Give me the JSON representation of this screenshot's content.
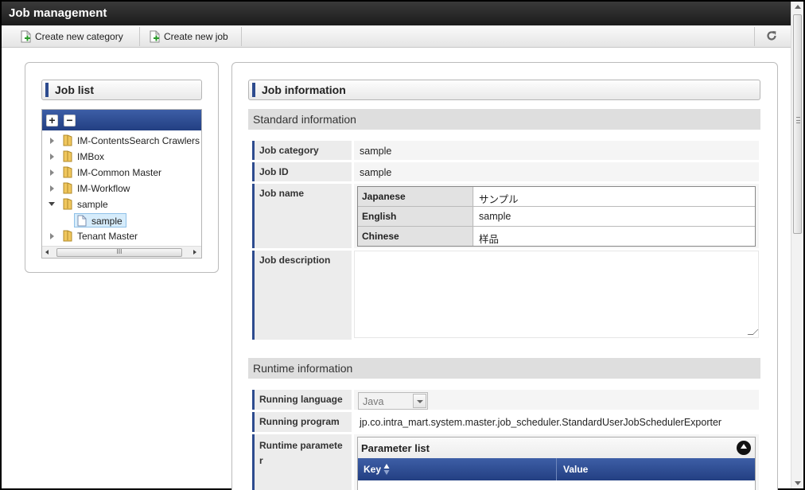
{
  "window": {
    "title": "Job management"
  },
  "toolbar": {
    "create_category_label": "Create new category",
    "create_job_label": "Create new job",
    "refresh_icon": "refresh-icon"
  },
  "job_list": {
    "title": "Job list",
    "expand_all": "+",
    "collapse_all": "−",
    "nodes": [
      {
        "label": "IM-ContentsSearch Crawlers",
        "expanded": false
      },
      {
        "label": "IMBox",
        "expanded": false
      },
      {
        "label": "IM-Common Master",
        "expanded": false
      },
      {
        "label": "IM-Workflow",
        "expanded": false
      },
      {
        "label": "sample",
        "expanded": true,
        "children": [
          {
            "label": "sample",
            "selected": true
          }
        ]
      },
      {
        "label": "Tenant Master",
        "expanded": false
      }
    ],
    "scroll_grip": "III"
  },
  "job_info": {
    "title": "Job information",
    "standard_section": "Standard information",
    "fields": {
      "category_label": "Job category",
      "category_value": "sample",
      "id_label": "Job ID",
      "id_value": "sample",
      "name_label": "Job name",
      "names": [
        {
          "lang": "Japanese",
          "value": "サンプル"
        },
        {
          "lang": "English",
          "value": "sample"
        },
        {
          "lang": "Chinese",
          "value": "样品"
        }
      ],
      "description_label": "Job description",
      "description_value": ""
    },
    "runtime_section": "Runtime information",
    "runtime": {
      "language_label": "Running language",
      "language_value": "Java",
      "program_label": "Running program",
      "program_value": "jp.co.intra_mart.system.master.job_scheduler.StandardUserJobSchedulerExporter",
      "parameter_label_1": "Runtime paramete",
      "parameter_label_2": "r",
      "parameter_list_title": "Parameter list",
      "col_key": "Key",
      "col_value": "Value"
    }
  },
  "colors": {
    "accent": "#2d4b8e",
    "header_bar": "#233f82",
    "titlebar": "#1c1c1c"
  }
}
